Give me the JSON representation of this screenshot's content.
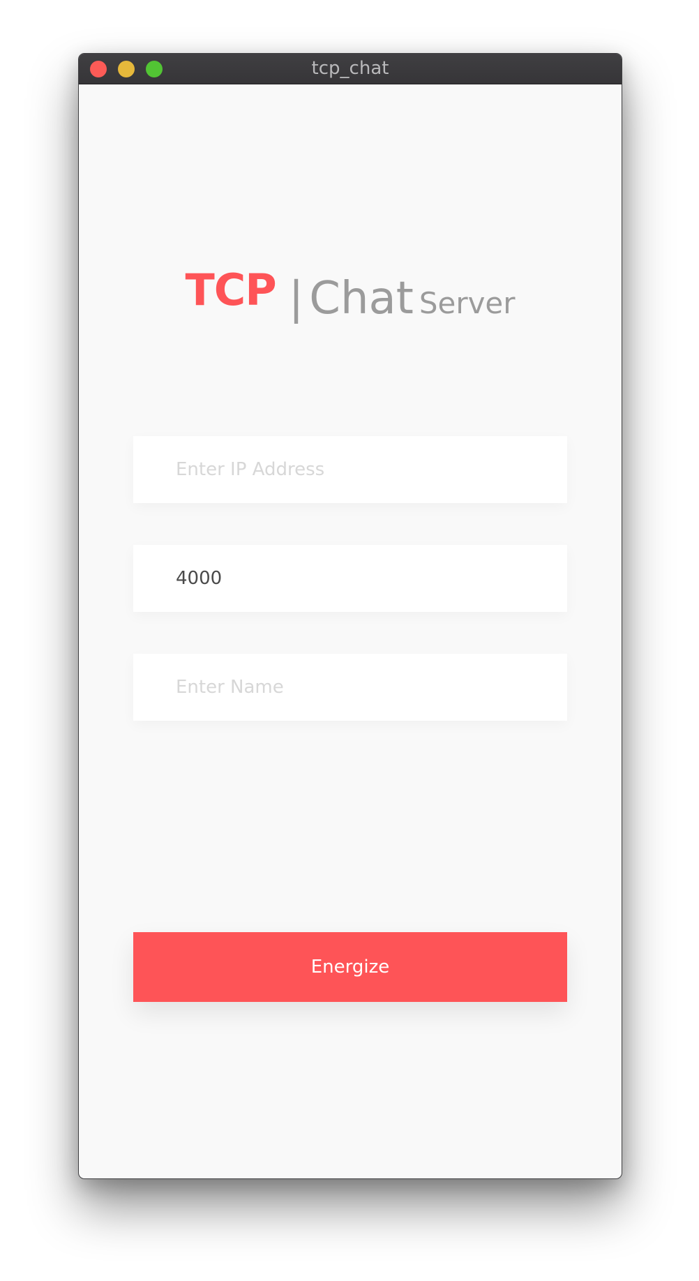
{
  "window": {
    "title": "tcp_chat",
    "controls": [
      "close",
      "minimize",
      "zoom"
    ]
  },
  "logo": {
    "primary": "TCP",
    "separator": "|",
    "secondary": "Chat",
    "tertiary": "Server"
  },
  "form": {
    "ip_field": {
      "placeholder": "Enter IP Address",
      "value": ""
    },
    "port_field": {
      "placeholder": "",
      "value": "4000"
    },
    "name_field": {
      "placeholder": "Enter Name",
      "value": ""
    },
    "submit_label": "Energize"
  },
  "colors": {
    "accent": "#fe5457",
    "logo_secondary": "#9b9b9b",
    "titlebar": "#3a393c",
    "background": "#f9f9f9"
  }
}
